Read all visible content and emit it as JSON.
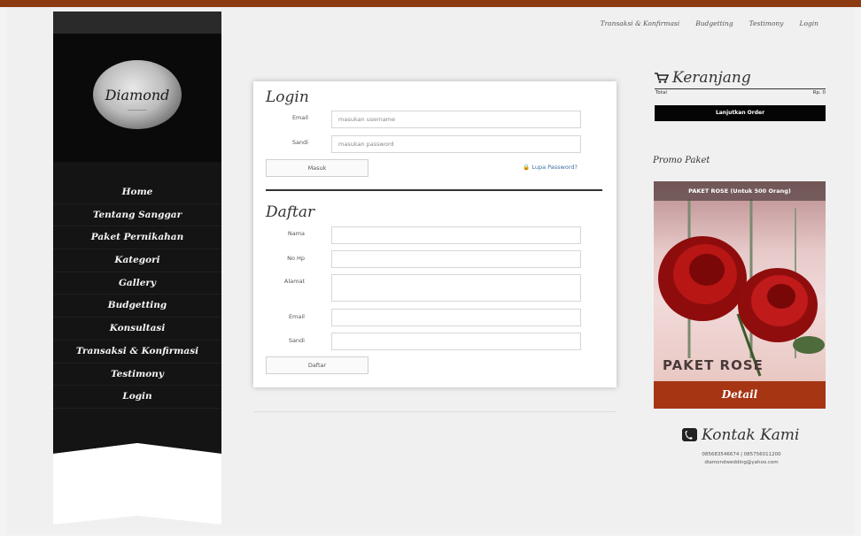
{
  "topnav": [
    "Transaksi & Konfirmasi",
    "Budgetting",
    "Testimony",
    "Login"
  ],
  "sidebar": {
    "logo_text": "Diamond",
    "menu": [
      "Home",
      "Tentang Sanggar",
      "Paket Pernikahan",
      "Kategori",
      "Gallery",
      "Budgetting",
      "Konsultasi",
      "Transaksi & Konfirmasi",
      "Testimony",
      "Login"
    ]
  },
  "login": {
    "title": "Login",
    "email_label": "Email",
    "email_placeholder": "masukan username",
    "sandi_label": "Sandi",
    "sandi_placeholder": "masukan password",
    "submit": "Masuk",
    "forgot": "Lupa Password?"
  },
  "daftar": {
    "title": "Daftar",
    "nama_label": "Nama",
    "nohp_label": "No Hp",
    "alamat_label": "Alamat",
    "email_label": "Email",
    "sandi_label": "Sandi",
    "submit": "Daftar"
  },
  "cart": {
    "title": "Keranjang",
    "total_label": "Total",
    "total_value": "Rp. 0",
    "order_button": "Lanjutkan Order"
  },
  "promo": {
    "label": "Promo Paket",
    "header": "PAKET ROSE (Untuk 500 Orang)",
    "caption": "PAKET ROSE",
    "detail_button": "Detail"
  },
  "contact": {
    "title": "Kontak Kami",
    "phones": "085683546674 | 085756011200",
    "email": "diamondwedding@yahoo.com"
  }
}
